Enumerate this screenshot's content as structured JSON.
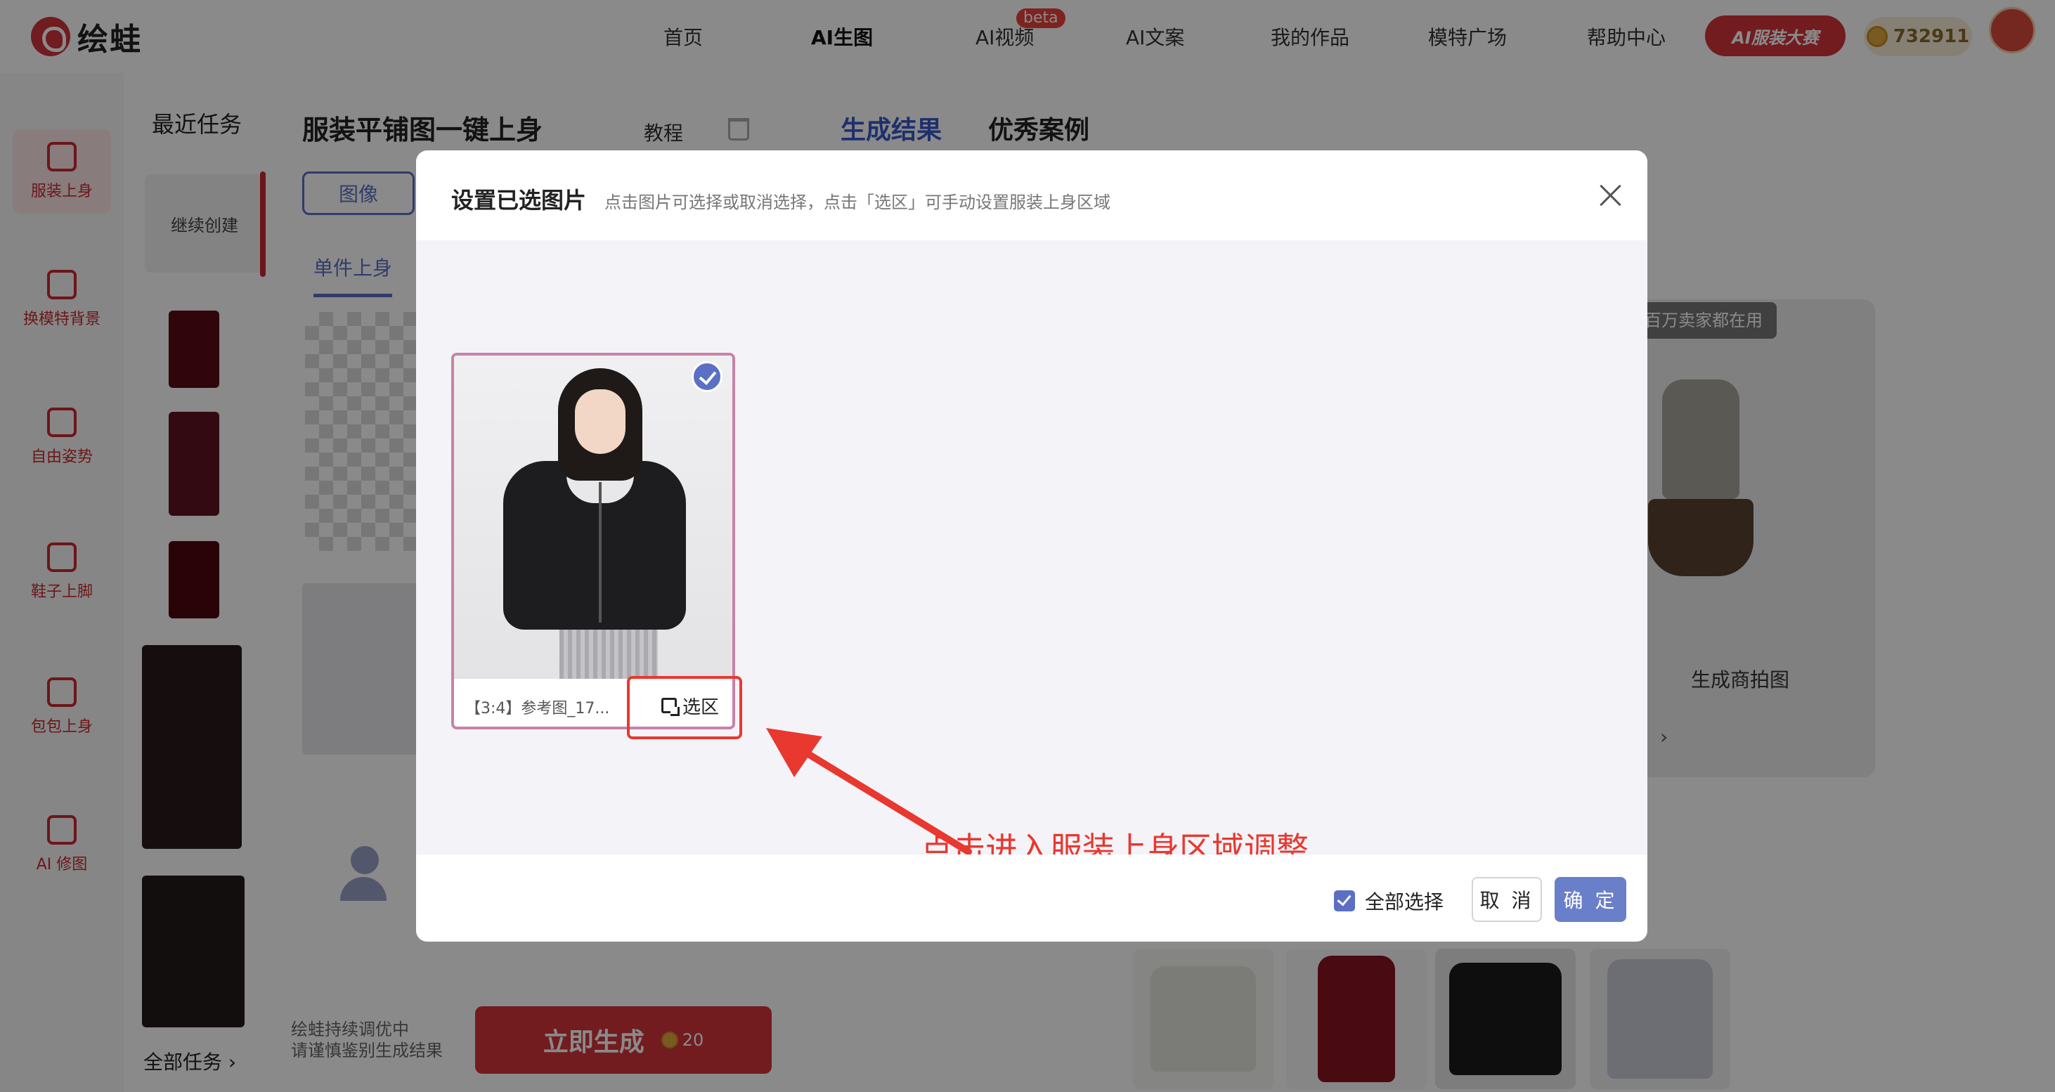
{
  "app": {
    "logo_text": "绘蛙"
  },
  "nav": {
    "items": [
      "首页",
      "AI生图",
      "AI视频",
      "AI文案",
      "我的作品",
      "模特广场",
      "帮助中心"
    ],
    "beta_badge": "beta",
    "contest_label": "AI服装大赛",
    "coins": "732911"
  },
  "tools": [
    "服装上身",
    "换模特背景",
    "自由姿势",
    "鞋子上脚",
    "包包上身",
    "AI 修图"
  ],
  "recent": {
    "title": "最近任务",
    "continue_label": "继续创建",
    "all_tasks": "全部任务 ›"
  },
  "panel": {
    "title": "服装平铺图一键上身",
    "tutorial": "教程",
    "image_button": "图像",
    "single_tab": "单件上身",
    "note_line1": "绘蛙持续调优中",
    "note_line2": "请谨慎鉴别生成结果",
    "generate_label": "立即生成",
    "generate_cost": "20"
  },
  "results": {
    "tab_active": "生成结果",
    "tab_alt": "优秀案例",
    "showcase_badge": "百万卖家都在用",
    "showcase_label": "生成商拍图",
    "showcase_arrow": "›"
  },
  "modal": {
    "title": "设置已选图片",
    "subtitle": "点击图片可选择或取消选择，点击「选区」可手动设置服装上身区域",
    "card_caption": "【3:4】参考图_17...",
    "select_button": "选区",
    "annotation": "点击进入服装上身区域调整",
    "select_all": "全部选择",
    "cancel": "取 消",
    "confirm": "确 定"
  },
  "colors": {
    "brand_red": "#d3343c",
    "accent_blue": "#5b6fc4",
    "annotation_red": "#e8382f"
  }
}
